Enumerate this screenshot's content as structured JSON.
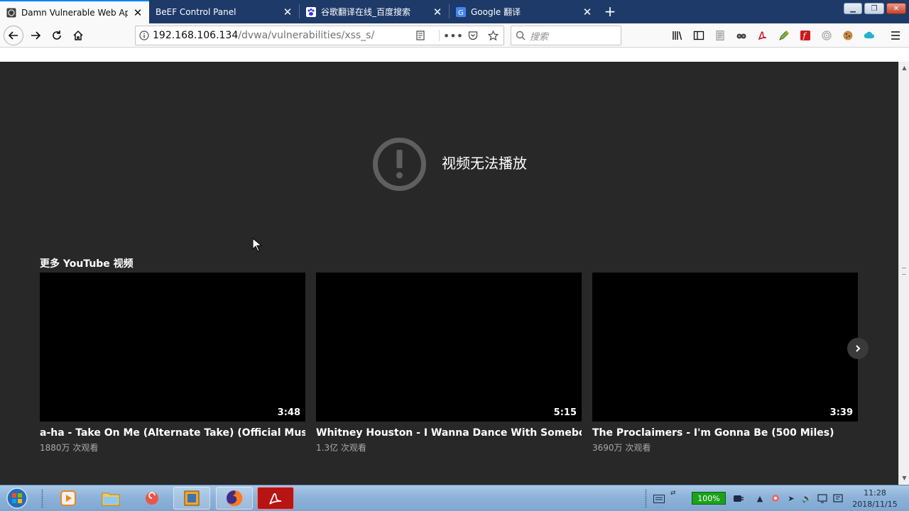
{
  "browser": {
    "tabs": [
      {
        "title": "Damn Vulnerable Web App",
        "active": true,
        "favicon": "dvwa-icon"
      },
      {
        "title": "BeEF Control Panel",
        "active": false,
        "favicon": ""
      },
      {
        "title": "谷歌翻译在线_百度搜索",
        "active": false,
        "favicon": "baidu-paw-icon"
      },
      {
        "title": "Google 翻译",
        "active": false,
        "favicon": "google-translate-icon"
      }
    ],
    "url_host": "192.168.106.134",
    "url_path": "/dvwa/vulnerabilities/xss_s/",
    "search_placeholder": "搜索"
  },
  "player": {
    "error_message": "视频无法播放",
    "more_heading": "更多 YouTube 视频",
    "videos": [
      {
        "title": "a-ha - Take On Me (Alternate Take) (Official Music Vid...",
        "views": "1880万 次观看",
        "duration": "3:48"
      },
      {
        "title": "Whitney Houston - I Wanna Dance With Somebody",
        "views": "1.3亿 次观看",
        "duration": "5:15"
      },
      {
        "title": "The Proclaimers - I'm Gonna Be (500 Miles)",
        "views": "3690万 次观看",
        "duration": "3:39"
      }
    ]
  },
  "taskbar": {
    "battery": "100%",
    "time": "11:28",
    "date": "2018/11/15"
  },
  "colors": {
    "tabstrip": "#1d3a68",
    "accent": "#0a84ff",
    "player_bg": "#282828"
  }
}
